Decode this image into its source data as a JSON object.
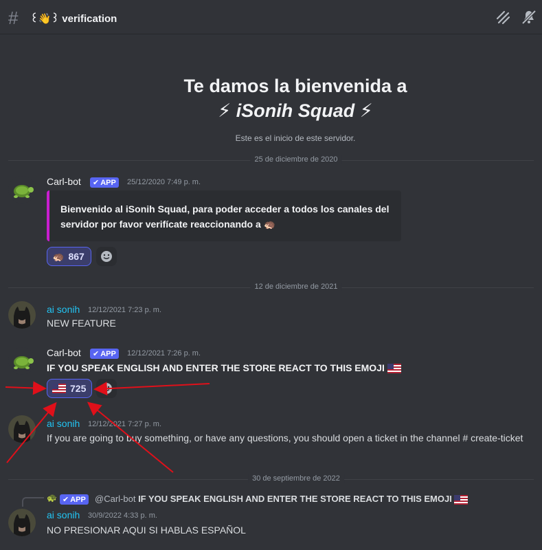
{
  "header": {
    "channel_name": "꒰👋꒱ verification"
  },
  "welcome": {
    "title_line1": "Te damos la bienvenida a",
    "title_line2": "⚡ iSonih Squad ⚡",
    "subtitle": "Este es el inicio de este servidor."
  },
  "dividers": [
    "25 de diciembre de 2020",
    "12 de diciembre de 2021",
    "30 de septiembre de 2022"
  ],
  "messages": [
    {
      "author": "Carl-bot",
      "badge": "APP",
      "timestamp": "25/12/2020 7:49 p. m.",
      "embed_text": "Bienvenido al iSonih Squad, para poder acceder a todos los canales del servidor por favor verifícate reaccionando a",
      "reaction_count": "867"
    },
    {
      "author": "ai sonih",
      "timestamp": "12/12/2021 7:23 p. m.",
      "text": "NEW FEATURE"
    },
    {
      "author": "Carl-bot",
      "badge": "APP",
      "timestamp": "12/12/2021 7:26 p. m.",
      "text": "IF YOU SPEAK ENGLISH AND ENTER THE STORE REACT TO THIS EMOJI",
      "reaction_count": "725"
    },
    {
      "author": "ai sonih",
      "timestamp": "12/12/2021 7:27 p. m.",
      "text": "If you are going to buy something, or have any questions, you should open a ticket in the channel # create-ticket"
    },
    {
      "reply_badge": "APP",
      "reply_author": "@Carl-bot",
      "reply_text": "IF YOU SPEAK ENGLISH AND ENTER THE STORE REACT TO THIS EMOJI",
      "author": "ai sonih",
      "timestamp": "30/9/2022 4:33 p. m.",
      "text": "NO PRESIONAR AQUI SI HABLAS ESPAÑOL"
    }
  ],
  "colors": {
    "background": "#313338",
    "accent": "#5865f2",
    "embed_border": "#c81ecf",
    "username_ai": "#22c5f4",
    "annotation_arrow": "#e0101a"
  }
}
